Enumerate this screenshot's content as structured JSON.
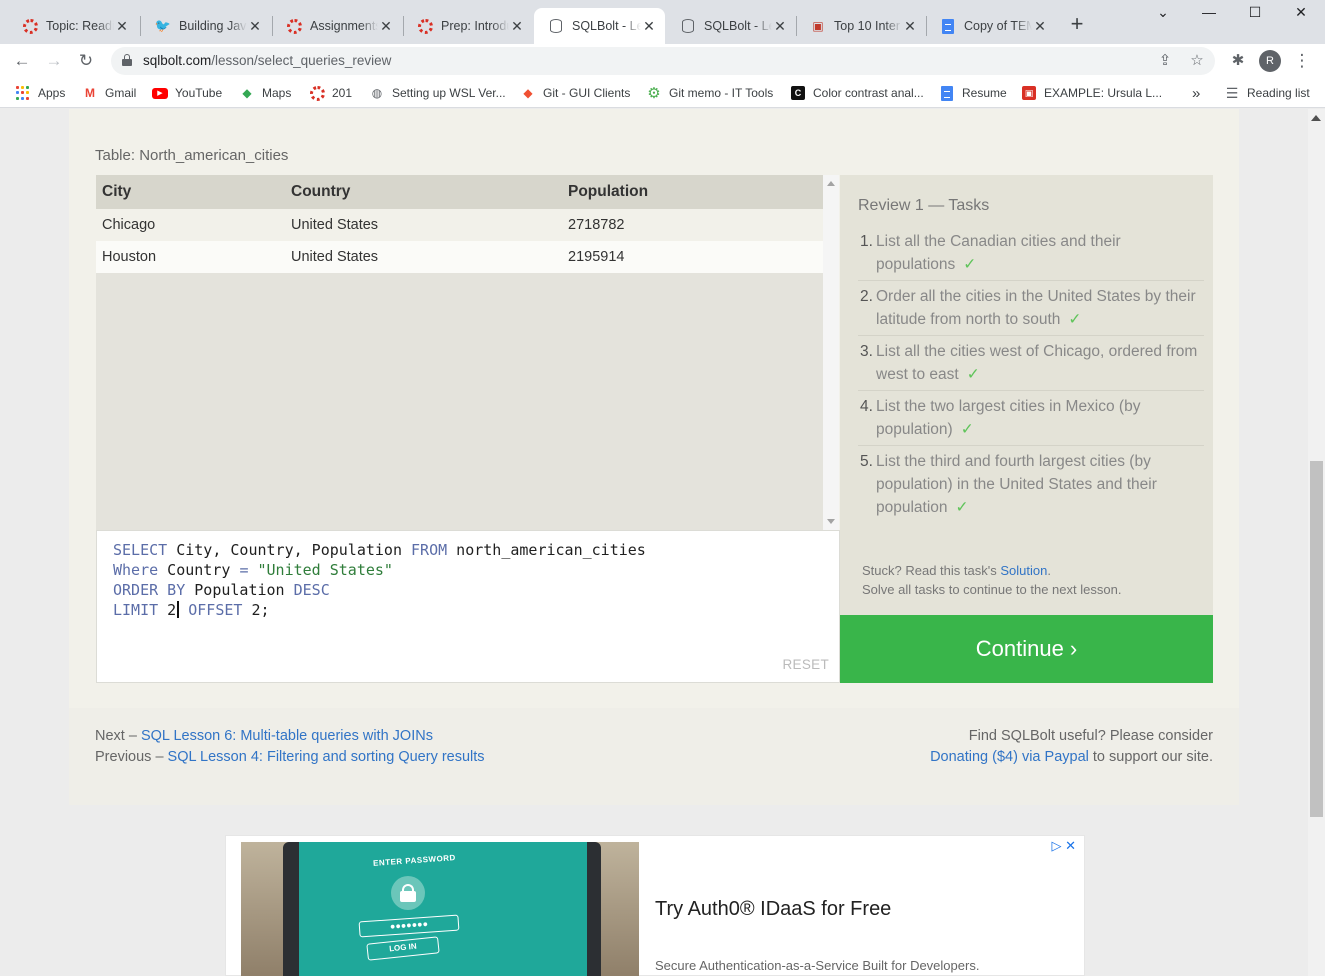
{
  "browser": {
    "tabs": [
      {
        "title": "Topic: Readi",
        "icon": "ring-icon",
        "active": false
      },
      {
        "title": "Building Java",
        "icon": "bird-icon",
        "active": false
      },
      {
        "title": "Assignments",
        "icon": "ring-icon",
        "active": false
      },
      {
        "title": "Prep: Introdu",
        "icon": "ring-icon",
        "active": false
      },
      {
        "title": "SQLBolt - Le",
        "icon": "database-icon",
        "active": true
      },
      {
        "title": "SQLBolt - Le",
        "icon": "database-icon",
        "active": false
      },
      {
        "title": "Top 10 Inter",
        "icon": "photo-icon",
        "active": false
      },
      {
        "title": "Copy of TEM",
        "icon": "doc-icon",
        "active": false
      }
    ],
    "url_host": "sqlbolt.com",
    "url_path": "/lesson/select_queries_review",
    "profile_initial": "R",
    "bookmarks": [
      {
        "label": "Apps"
      },
      {
        "label": "Gmail"
      },
      {
        "label": "YouTube"
      },
      {
        "label": "Maps"
      },
      {
        "label": "201"
      },
      {
        "label": "Setting up WSL Ver..."
      },
      {
        "label": "Git - GUI Clients"
      },
      {
        "label": "Git memo - IT Tools"
      },
      {
        "label": "Color contrast anal..."
      },
      {
        "label": "Resume"
      },
      {
        "label": "EXAMPLE: Ursula L..."
      }
    ],
    "bookmarks_overflow": "»",
    "reading_list": "Reading list"
  },
  "lesson": {
    "table_label": "Table: North_american_cities",
    "table": {
      "columns": [
        "City",
        "Country",
        "Population"
      ],
      "rows": [
        [
          "Chicago",
          "United States",
          "2718782"
        ],
        [
          "Houston",
          "United States",
          "2195914"
        ]
      ]
    },
    "query": {
      "line1_kw1": "SELECT",
      "line1_cols": " City, Country, Population ",
      "line1_kw2": "FROM",
      "line1_table": " north_american_cities",
      "line2_kw": "Where",
      "line2_field": " Country ",
      "line2_op": "=",
      "line2_space": " ",
      "line2_str": "\"United States\"",
      "line3_kw1": "ORDER BY",
      "line3_field": " Population ",
      "line3_kw2": "DESC",
      "line4_kw1": "LIMIT",
      "line4_num1": " 2",
      "line4_kw2": " OFFSET",
      "line4_num2": " 2;"
    },
    "reset_label": "RESET",
    "tasks_title": "Review 1 — Tasks",
    "tasks": [
      {
        "num": "1.",
        "text": "List all the Canadian cities and their populations",
        "done": "✓"
      },
      {
        "num": "2.",
        "text": "Order all the cities in the United States by their latitude from north to south",
        "done": "✓"
      },
      {
        "num": "3.",
        "text": "List all the cities west of Chicago, ordered from west to east",
        "done": "✓"
      },
      {
        "num": "4.",
        "text": "List the two largest cities in Mexico (by population)",
        "done": "✓"
      },
      {
        "num": "5.",
        "text": "List the third and fourth largest cities (by population) in the United States and their population",
        "done": "✓"
      }
    ],
    "stuck_prefix": "Stuck? Read this task's ",
    "solution_link": "Solution",
    "stuck_suffix": ".",
    "solve_all": "Solve all tasks to continue to the next lesson.",
    "continue_label": "Continue ›"
  },
  "footer": {
    "next_prefix": "Next – ",
    "next_link": "SQL Lesson 6: Multi-table queries with JOINs",
    "prev_prefix": "Previous – ",
    "prev_link": "SQL Lesson 4: Filtering and sorting Query results",
    "useful": "Find SQLBolt useful? Please consider",
    "donate_link": "Donating ($4) via Paypal",
    "donate_suffix": " to support our site."
  },
  "ad": {
    "img_enter": "ENTER PASSWORD",
    "img_password": "●●●●●●●",
    "img_login": "LOG IN",
    "title": "Try Auth0® IDaaS for Free",
    "subtitle": "Secure Authentication-as-a-Service Built for Developers.",
    "choices": "▷ ✕"
  },
  "colors": {
    "accent_green": "#39b54a",
    "link_blue": "#3174c6",
    "keyword": "#5b6da8",
    "string": "#2f7d3a"
  }
}
